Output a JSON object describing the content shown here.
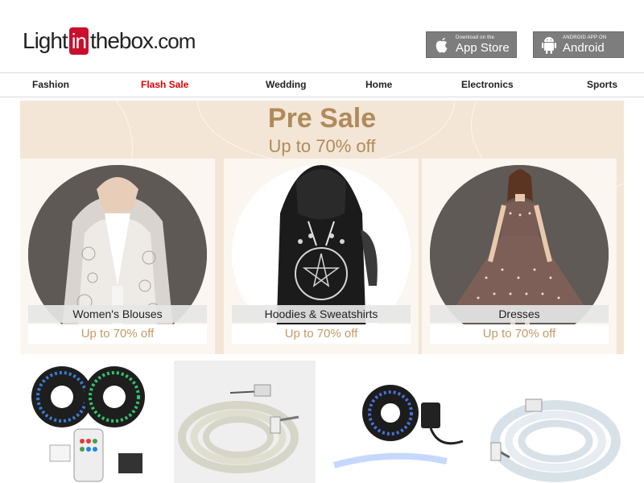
{
  "logo": {
    "part1": "Light",
    "part2": "in",
    "part3": "thebox",
    "part4": ".com"
  },
  "store_buttons": {
    "apple": {
      "small": "Download on the",
      "big": "App Store",
      "icon": "apple-icon"
    },
    "android": {
      "small": "ANDROID APP ON",
      "big": "Android",
      "icon": "android-icon"
    }
  },
  "nav": {
    "items": [
      {
        "label": "Fashion"
      },
      {
        "label": "Flash Sale",
        "color": "#e40000"
      },
      {
        "label": "Wedding"
      },
      {
        "label": "Home"
      },
      {
        "label": "Electronics"
      },
      {
        "label": "Sports"
      }
    ]
  },
  "banner": {
    "title": "Pre Sale",
    "subtitle": "Up to 70% off",
    "background": "#f3e6d6",
    "accent": "#b08a5b",
    "cards": [
      {
        "label": "Women's Blouses",
        "promo": "Up to 70% off"
      },
      {
        "label": "Hoodies & Sweatshirts",
        "promo": "Up to 70% off"
      },
      {
        "label": "Dresses",
        "promo": "Up to 70% off"
      }
    ]
  },
  "products": [
    {
      "name": "rgb-led-strip-kit"
    },
    {
      "name": "led-strip-roll-with-plug"
    },
    {
      "name": "led-strip-kit-with-adapter"
    },
    {
      "name": "led-strip-coil-with-plug"
    }
  ]
}
